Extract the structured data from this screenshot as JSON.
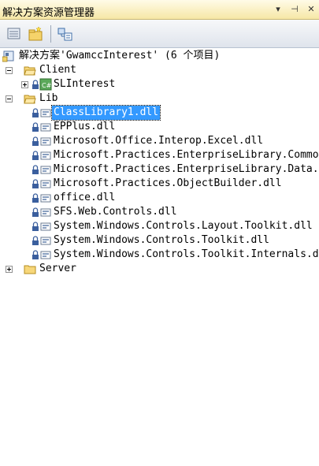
{
  "window": {
    "title": "解决方案资源管理器",
    "buttons": [
      "▾",
      "⊣",
      "✕"
    ]
  },
  "toolbar": {
    "buttons": [
      "properties-icon",
      "show-all-files-icon",
      "view-class-diagram-icon"
    ]
  },
  "tree": {
    "solution": "解决方案'GwamccInterest' (6 个项目)",
    "client": {
      "label": "Client",
      "children": [
        {
          "label": "SLInterest",
          "icon": "csharp-project-icon"
        }
      ]
    },
    "lib": {
      "label": "Lib",
      "files": [
        "ClassLibrary1.dll",
        "EPPlus.dll",
        "Microsoft.Office.Interop.Excel.dll",
        "Microsoft.Practices.EnterpriseLibrary.Common.dll",
        "Microsoft.Practices.EnterpriseLibrary.Data.dll",
        "Microsoft.Practices.ObjectBuilder.dll",
        "office.dll",
        "SFS.Web.Controls.dll",
        "System.Windows.Controls.Layout.Toolkit.dll",
        "System.Windows.Controls.Toolkit.dll",
        "System.Windows.Controls.Toolkit.Internals.dll"
      ],
      "selected_index": 0
    },
    "server": {
      "label": "Server"
    }
  },
  "colors": {
    "selection": "#3399ff",
    "title_bar": "#f6e7a6",
    "toolbar": "#dfe4ec"
  }
}
